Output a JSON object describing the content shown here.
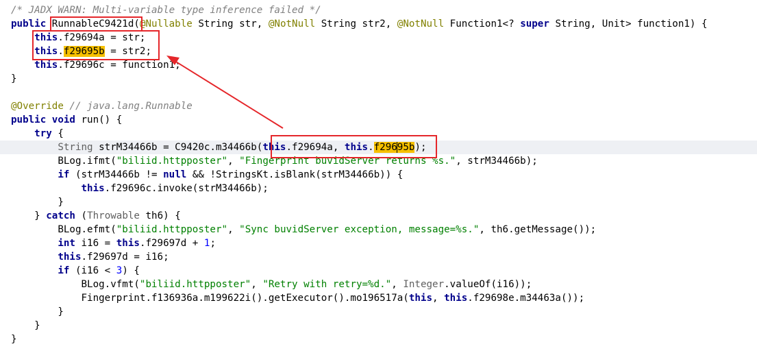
{
  "editor": {
    "highlight_color": "#f6c000",
    "annotation_color": "#e5262a",
    "lines": {
      "l1": {
        "comment": "/* JADX WARN: Multi-variable type inference failed */"
      },
      "l2": {
        "kw_public": "public",
        "class_name": "RunnableC9421d",
        "open": "(",
        "ann1": "@Nullable",
        "p1": " String str, ",
        "ann2": "@NotNull",
        "p2": " String str2, ",
        "ann3": "@NotNull",
        "p3": " Function1<? ",
        "kw_super": "super",
        "p4": " String, Unit> function1) {"
      },
      "l3": {
        "kw_this": "this",
        "rest": ".f29694a = str;"
      },
      "l4": {
        "kw_this": "this",
        "dot": ".",
        "field": "f29695b",
        "rest": " = str2;"
      },
      "l5": {
        "kw_this": "this",
        "rest": ".f29696c = function1;"
      },
      "l6": {
        "text": "}"
      },
      "l8": {
        "ann": "@Override",
        "comment": " // java.lang.Runnable"
      },
      "l9": {
        "kw_public": "public",
        "kw_void": "void",
        "rest": " run() {"
      },
      "l10": {
        "kw_try": "try",
        "rest": " {"
      },
      "l11": {
        "type": "String",
        "pre": " strM34466b = C9420c.m34466b",
        "open": "(",
        "kw_this1": "this",
        "mid": ".f29694a, ",
        "kw_this2": "this",
        "dot": ".",
        "field_a": "f296",
        "field_b": "95b",
        "close": ")",
        "end": ";"
      },
      "l12": {
        "pre": "BLog.ifmt(",
        "s1": "\"biliid.httpposter\"",
        "sep": ", ",
        "s2": "\"Fingerprint buvidServer returns %s.\"",
        "rest": ", strM34466b);"
      },
      "l13": {
        "kw_if": "if",
        "pre": " (strM34466b != ",
        "kw_null": "null",
        "rest": " && !StringsKt.isBlank(strM34466b)) {"
      },
      "l14": {
        "kw_this": "this",
        "rest": ".f29696c.invoke(strM34466b);"
      },
      "l15": {
        "text": "}"
      },
      "l16": {
        "pre": "} ",
        "kw_catch": "catch",
        "open": " (",
        "type": "Throwable",
        "rest": " th6) {"
      },
      "l17": {
        "pre": "BLog.efmt(",
        "s1": "\"biliid.httpposter\"",
        "sep": ", ",
        "s2": "\"Sync buvidServer exception, message=%s.\"",
        "rest": ", th6.getMessage());"
      },
      "l18": {
        "kw_int": "int",
        "pre": " i16 = ",
        "kw_this": "this",
        "rest": ".f29697d + ",
        "num": "1",
        "end": ";"
      },
      "l19": {
        "kw_this": "this",
        "rest": ".f29697d = i16;"
      },
      "l20": {
        "kw_if": "if",
        "pre": " (i16 < ",
        "num": "3",
        "rest": ") {"
      },
      "l21": {
        "pre": "BLog.vfmt(",
        "s1": "\"biliid.httpposter\"",
        "sep": ", ",
        "s2": "\"Retry with retry=%d.\"",
        "sep2": ", ",
        "type": "Integer",
        "rest": ".valueOf(i16));"
      },
      "l22": {
        "pre": "Fingerprint.f136936a.m199622i().getExecutor().mo196517a(",
        "kw_this1": "this",
        "sep": ", ",
        "kw_this2": "this",
        "rest": ".f29698e.m34463a());"
      },
      "l23": {
        "text": "}"
      },
      "l24": {
        "text": "}"
      },
      "l25": {
        "text": "}"
      }
    }
  }
}
